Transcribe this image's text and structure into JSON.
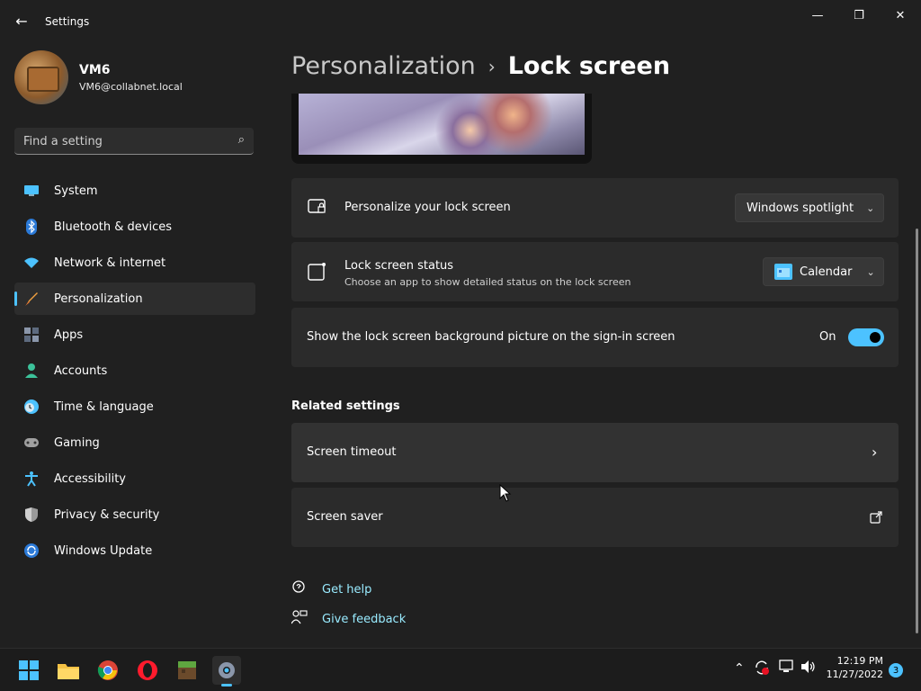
{
  "window": {
    "title": "Settings",
    "back_icon": "←",
    "minimize_icon": "—",
    "maximize_icon": "❐",
    "close_icon": "✕"
  },
  "profile": {
    "name": "VM6",
    "email": "VM6@collabnet.local"
  },
  "search": {
    "placeholder": "Find a setting",
    "icon": "⌕"
  },
  "sidebar": {
    "items": [
      {
        "label": "System",
        "icon": "monitor-icon",
        "color": "#4cc2ff"
      },
      {
        "label": "Bluetooth & devices",
        "icon": "bluetooth-icon",
        "color": "#4c9bff"
      },
      {
        "label": "Network & internet",
        "icon": "wifi-icon",
        "color": "#4cc2ff"
      },
      {
        "label": "Personalization",
        "icon": "brush-icon",
        "color": "#f0a040",
        "active": true
      },
      {
        "label": "Apps",
        "icon": "apps-icon",
        "color": "#9aa5b8"
      },
      {
        "label": "Accounts",
        "icon": "person-icon",
        "color": "#3cc29a"
      },
      {
        "label": "Time & language",
        "icon": "clock-globe-icon",
        "color": "#4cc2ff"
      },
      {
        "label": "Gaming",
        "icon": "gamepad-icon",
        "color": "#a0a0a0"
      },
      {
        "label": "Accessibility",
        "icon": "accessibility-icon",
        "color": "#4cc2ff"
      },
      {
        "label": "Privacy & security",
        "icon": "shield-icon",
        "color": "#a0a0a0"
      },
      {
        "label": "Windows Update",
        "icon": "update-icon",
        "color": "#4cc2ff"
      }
    ]
  },
  "breadcrumb": {
    "parent": "Personalization",
    "separator": "›",
    "current": "Lock screen"
  },
  "settings": {
    "personalize": {
      "title": "Personalize your lock screen",
      "value": "Windows spotlight"
    },
    "status": {
      "title": "Lock screen status",
      "subtitle": "Choose an app to show detailed status on the lock screen",
      "value": "Calendar"
    },
    "signin_background": {
      "title": "Show the lock screen background picture on the sign-in screen",
      "state_label": "On",
      "enabled": true
    }
  },
  "related": {
    "heading": "Related settings",
    "screen_timeout": "Screen timeout",
    "screen_saver": "Screen saver"
  },
  "help": {
    "get_help": "Get help",
    "give_feedback": "Give feedback"
  },
  "taskbar": {
    "time": "12:19 PM",
    "date": "11/27/2022",
    "notification_count": "3"
  },
  "colors": {
    "accent": "#4cc2ff",
    "background": "#202020",
    "card": "#2b2b2b",
    "link": "#99ebff"
  }
}
